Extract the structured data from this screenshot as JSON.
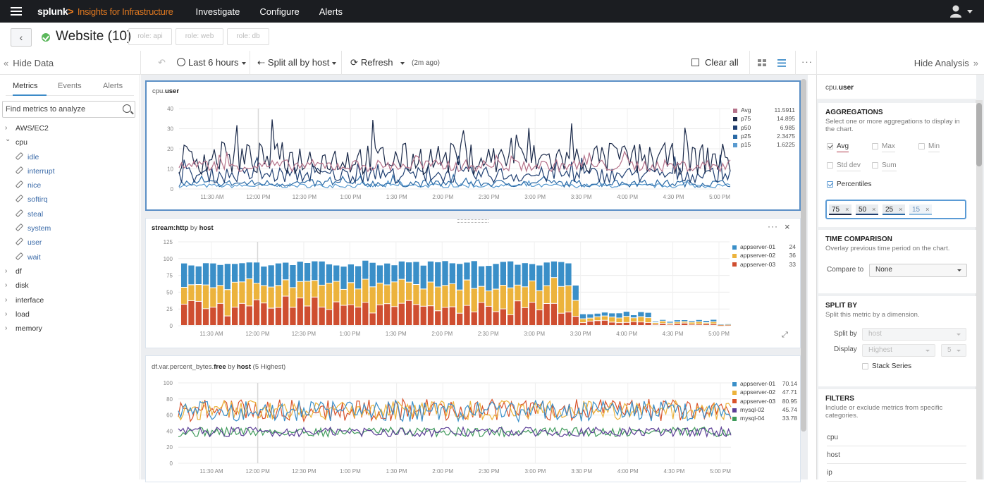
{
  "topbar": {
    "logo": "splunk",
    "logo_chevron": ">",
    "product": "Insights for Infrastructure",
    "nav": [
      "Investigate",
      "Configure",
      "Alerts"
    ]
  },
  "titlebar": {
    "back_icon": "chevron-left",
    "status": "healthy",
    "title": "Website (10)",
    "roles": [
      "role: api",
      "role: web",
      "role: db"
    ]
  },
  "toolbar": {
    "hide_data": "Hide Data",
    "time_range": "Last 6 hours",
    "split": "Split all by host",
    "refresh": "Refresh",
    "refreshed": "(2m ago)",
    "clear_all": "Clear all",
    "hide_analysis": "Hide Analysis"
  },
  "sidebar": {
    "tabs": [
      "Metrics",
      "Events",
      "Alerts"
    ],
    "active_tab": "Metrics",
    "search_placeholder": "Find metrics to analyze",
    "tree": [
      {
        "label": "AWS/EC2",
        "expanded": false
      },
      {
        "label": "cpu",
        "expanded": true,
        "children": [
          "idle",
          "interrupt",
          "nice",
          "softirq",
          "steal",
          "system",
          "user",
          "wait"
        ]
      },
      {
        "label": "df",
        "expanded": false
      },
      {
        "label": "disk",
        "expanded": false
      },
      {
        "label": "interface",
        "expanded": false
      },
      {
        "label": "load",
        "expanded": false
      },
      {
        "label": "memory",
        "expanded": false
      }
    ]
  },
  "chart_data": [
    {
      "type": "line",
      "title_prefix": "cpu.",
      "title_bold": "user",
      "ylim": [
        0,
        40
      ],
      "yticks": [
        0,
        10,
        20,
        30,
        40
      ],
      "xticks": [
        "11:30 AM",
        "12:00 PM",
        "12:30 PM",
        "1:00 PM",
        "1:30 PM",
        "2:00 PM",
        "2:30 PM",
        "3:00 PM",
        "3:30 PM",
        "4:00 PM",
        "4:30 PM",
        "5:00 PM"
      ],
      "grid": true,
      "legend": "right",
      "series": [
        {
          "name": "Avg",
          "value": "11.5911",
          "color": "#b5728a",
          "mean": 11.6,
          "amp": 3
        },
        {
          "name": "p75",
          "value": "14.895",
          "color": "#1b2a4a",
          "mean": 15,
          "amp": 8
        },
        {
          "name": "p50",
          "value": "6.985",
          "color": "#1f3f72",
          "mean": 7,
          "amp": 4
        },
        {
          "name": "p25",
          "value": "2.3475",
          "color": "#2a6aa6",
          "mean": 2.8,
          "amp": 1.8
        },
        {
          "name": "p15",
          "value": "1.6225",
          "color": "#5a9bd0",
          "mean": 1.6,
          "amp": 1
        }
      ]
    },
    {
      "type": "bar",
      "stacked": true,
      "title_bold_1": "stream:http",
      "title_mid": " by ",
      "title_bold_2": "host",
      "ylim": [
        0,
        125
      ],
      "yticks": [
        0,
        25,
        50,
        75,
        100,
        125
      ],
      "xticks": [
        "11:30 AM",
        "12:00 PM",
        "12:30 PM",
        "1:00 PM",
        "1:30 PM",
        "2:00 PM",
        "2:30 PM",
        "3:00 PM",
        "3:30 PM",
        "4:00 PM",
        "4:30 PM",
        "5:00 PM"
      ],
      "grid": true,
      "legend": "right",
      "series": [
        {
          "name": "appserver-01",
          "value": "24",
          "color": "#3a8fc8"
        },
        {
          "name": "appserver-02",
          "value": "36",
          "color": "#ecb33c"
        },
        {
          "name": "appserver-03",
          "value": "33",
          "color": "#cf4e30"
        }
      ],
      "phases": [
        {
          "bars": 52,
          "total": [
            88,
            97
          ],
          "split": [
            0.34,
            0.32,
            0.34
          ]
        },
        {
          "bars": 3,
          "values_total": [
            95,
            93,
            60
          ]
        },
        {
          "bars": 10,
          "total": [
            15,
            22
          ]
        },
        {
          "bars": 9,
          "total": [
            5,
            9
          ]
        },
        {
          "bars": 2,
          "total": [
            2,
            3
          ]
        }
      ]
    },
    {
      "type": "line",
      "title_prefix": "df.var.percent_bytes.",
      "title_bold": "free",
      "title_mid": " by ",
      "title_bold_2": "host",
      "title_suffix": " (5 Highest)",
      "ylim": [
        0,
        100
      ],
      "yticks": [
        0,
        20,
        40,
        60,
        80,
        100
      ],
      "xticks": [
        "11:30 AM",
        "12:00 PM",
        "12:30 PM",
        "1:00 PM",
        "1:30 PM",
        "2:00 PM",
        "2:30 PM",
        "3:00 PM",
        "3:30 PM",
        "4:00 PM",
        "4:30 PM",
        "5:00 PM"
      ],
      "grid": true,
      "legend": "right",
      "series": [
        {
          "name": "appserver-01",
          "value": "70.14",
          "color": "#3a8fc8",
          "mean": 65,
          "amp": 13
        },
        {
          "name": "appserver-02",
          "value": "47.71",
          "color": "#ecb33c",
          "mean": 66,
          "amp": 12
        },
        {
          "name": "appserver-03",
          "value": "80.95",
          "color": "#d9542c",
          "mean": 66,
          "amp": 14
        },
        {
          "name": "mysql-02",
          "value": "45.74",
          "color": "#5b3e96",
          "mean": 39,
          "amp": 6
        },
        {
          "name": "mysql-04",
          "value": "33.78",
          "color": "#3e9a5a",
          "mean": 39,
          "amp": 6
        }
      ]
    }
  ],
  "analysis": {
    "metric_prefix": "cpu.",
    "metric_bold": "user",
    "aggregations": {
      "heading": "AGGREGATIONS",
      "desc": "Select one or more aggregations to display in the chart.",
      "options": [
        {
          "label": "Avg",
          "checked": true
        },
        {
          "label": "Max",
          "checked": false
        },
        {
          "label": "Min",
          "checked": false
        },
        {
          "label": "Std dev",
          "checked": false
        },
        {
          "label": "Sum",
          "checked": false
        }
      ],
      "percentiles_label": "Percentiles",
      "percentiles_checked": true,
      "percentiles": [
        "75",
        "50",
        "25",
        "15"
      ]
    },
    "time_comparison": {
      "heading": "TIME COMPARISON",
      "desc": "Overlay previous time period on the chart.",
      "compare_label": "Compare to",
      "compare_value": "None"
    },
    "split_by": {
      "heading": "SPLIT BY",
      "desc": "Split this metric by a dimension.",
      "split_label": "Split by",
      "split_value": "host",
      "display_label": "Display",
      "display_value": "Highest",
      "display_count": "5",
      "stack_label": "Stack Series"
    },
    "filters": {
      "heading": "FILTERS",
      "desc": "Include or exclude metrics from specific categories.",
      "items": [
        "cpu",
        "host",
        "ip"
      ]
    }
  }
}
